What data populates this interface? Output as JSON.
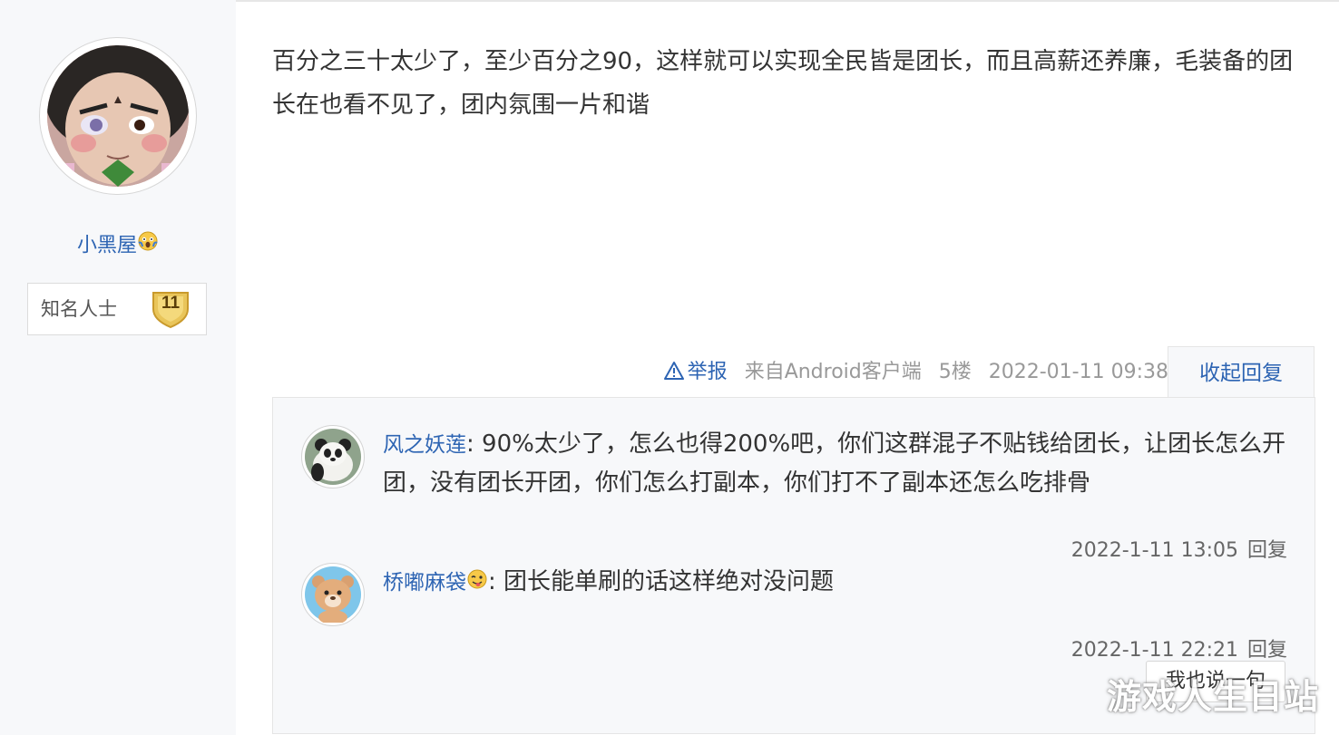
{
  "author": {
    "name": "小黑屋",
    "name_emoji": "scream-emoji",
    "avatar": "calabash-brother-avatar",
    "badge": {
      "title": "知名人士",
      "level": "11"
    }
  },
  "post": {
    "content": "百分之三十太少了，至少百分之90，这样就可以实现全民皆是团长，而且高薪还养廉，毛装备的团长在也看不见了，团内氛围一片和谐",
    "tail": {
      "report_label": "举报",
      "source": "来自Android客户端",
      "floor": "5楼",
      "time": "2022-01-11 09:38"
    },
    "collapse_label": "收起回复"
  },
  "replies": [
    {
      "user": "风之妖莲",
      "avatar": "panda-avatar",
      "text": ": 90%太少了，怎么也得200%吧，你们这群混子不贴钱给团长，让团长怎么开团，没有团长开团，你们怎么打副本，你们打不了副本还怎么吃排骨",
      "time": "2022-1-11 13:05",
      "reply_label": "回复"
    },
    {
      "user": "桥嘟麻袋",
      "user_emoji": "tongue-wink-emoji",
      "avatar": "bear-avatar",
      "text": ": 团长能单刷的话这样绝对没问题",
      "time": "2022-1-11 22:21",
      "reply_label": "回复"
    }
  ],
  "say_button_label": "我也说一句",
  "watermark": "游戏人生日站",
  "colors": {
    "link": "#2d64b3",
    "panel": "#f7f8fa",
    "badge_gold": "#e9c55a"
  }
}
